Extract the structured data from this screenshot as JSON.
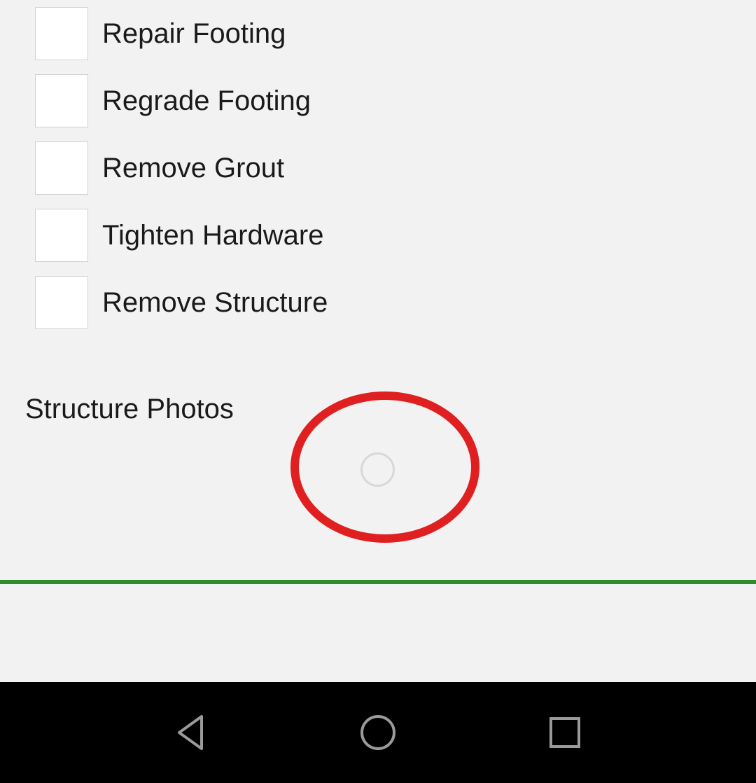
{
  "checkboxes": [
    {
      "label": "Repair Footing"
    },
    {
      "label": "Regrade Footing"
    },
    {
      "label": "Remove Grout"
    },
    {
      "label": "Tighten Hardware"
    },
    {
      "label": "Remove Structure"
    }
  ],
  "section_title": "Structure Photos"
}
